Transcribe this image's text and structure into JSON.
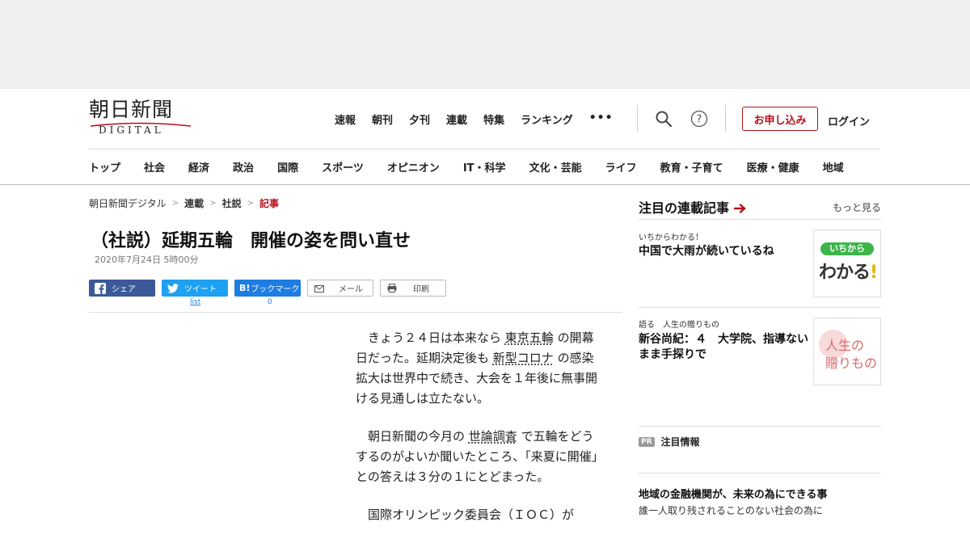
{
  "header": {
    "logo_kanji": "朝日新聞",
    "logo_sub": "DIGITAL",
    "topnav": [
      "速報",
      "朝刊",
      "夕刊",
      "連載",
      "特集",
      "ランキング",
      "•••"
    ],
    "apply_label": "お申し込み",
    "login_label": "ログイン"
  },
  "categories": [
    "トップ",
    "社会",
    "経済",
    "政治",
    "国際",
    "スポーツ",
    "オピニオン",
    "IT・科学",
    "文化・芸能",
    "ライフ",
    "教育・子育て",
    "医療・健康",
    "地域"
  ],
  "breadcrumb": [
    "朝日新聞デジタル",
    "連載",
    "社説",
    "記事"
  ],
  "article": {
    "title": "（社説）延期五輪　開催の姿を問い直せ",
    "date": "2020年7月24日 5時00分",
    "share": {
      "facebook": "シェア",
      "twitter": "ツイート",
      "hatena": "ブックマーク",
      "mail": "メール",
      "print": "印刷",
      "twitter_count": "list",
      "hatena_count": "0"
    },
    "p1_a": "きょう２４日は本来なら",
    "p1_link1": "東京五輪",
    "p1_b": "の開幕日だった。延期決定後も",
    "p1_link2": "新型コロナ",
    "p1_c": "の感染拡大は世界中で続き、大会を１年後に無事開ける見通しは立たない。",
    "p2_a": "朝日新聞の今月の",
    "p2_link": "世論調査",
    "p2_b": "で五輪をどうするのがよいか聞いたところ、「来夏に開催」との答えは３分の１にとどまった。",
    "p3": "国際オリンピック委員会（ＩＯＣ）が"
  },
  "rail": {
    "heading": "注目の連載記事",
    "more": "もっと見る",
    "items": [
      {
        "kicker": "いちからわかる！",
        "title": "中国で大雨が続いているね",
        "thumb_top": "いちから",
        "thumb_main": "わかる",
        "thumb_mark": "!"
      },
      {
        "kicker": "語る　人生の贈りもの",
        "title": "新谷尚紀：４　大学院、指導ないまま手探りで",
        "thumb_l1": "人生の",
        "thumb_l2": "贈りもの"
      }
    ],
    "pr_badge": "PR",
    "pr_heading": "注目情報",
    "pr_title": "地域の金融機関が、未来の為にできる事",
    "pr_sub": "誰一人取り残されることのない社会の為に"
  },
  "colors": {
    "brand_red": "#b5121b",
    "facebook": "#3b5998",
    "twitter": "#1da1f2",
    "hatena": "#1d7de2"
  }
}
